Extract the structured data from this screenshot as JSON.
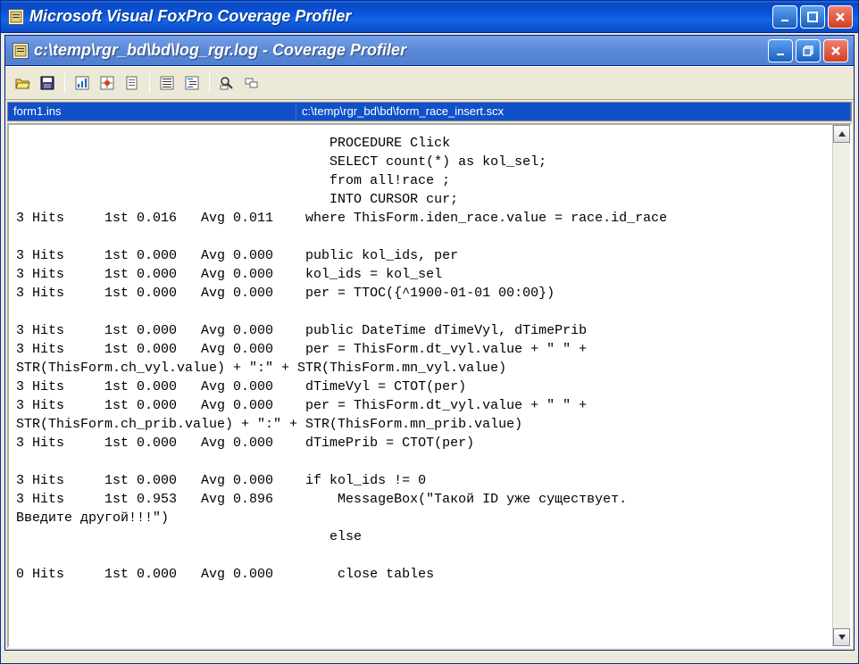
{
  "outer": {
    "title": "Microsoft Visual FoxPro Coverage Profiler"
  },
  "inner": {
    "title": "c:\\temp\\rgr_bd\\bd\\log_rgr.log - Coverage Profiler"
  },
  "header": {
    "col1": "form1.ins",
    "col2": "c:\\temp\\rgr_bd\\bd\\form_race_insert.scx"
  },
  "code_lines": [
    "                                       PROCEDURE Click",
    "                                       SELECT count(*) as kol_sel;",
    "                                       from all!race ;",
    "                                       INTO CURSOR cur;",
    "3 Hits     1st 0.016   Avg 0.011    where ThisForm.iden_race.value = race.id_race",
    "",
    "3 Hits     1st 0.000   Avg 0.000    public kol_ids, per",
    "3 Hits     1st 0.000   Avg 0.000    kol_ids = kol_sel",
    "3 Hits     1st 0.000   Avg 0.000    per = TTOC({^1900-01-01 00:00})",
    "",
    "3 Hits     1st 0.000   Avg 0.000    public DateTime dTimeVyl, dTimePrib",
    "3 Hits     1st 0.000   Avg 0.000    per = ThisForm.dt_vyl.value + \" \" +",
    "STR(ThisForm.ch_vyl.value) + \":\" + STR(ThisForm.mn_vyl.value)",
    "3 Hits     1st 0.000   Avg 0.000    dTimeVyl = CTOT(per)",
    "3 Hits     1st 0.000   Avg 0.000    per = ThisForm.dt_vyl.value + \" \" +",
    "STR(ThisForm.ch_prib.value) + \":\" + STR(ThisForm.mn_prib.value)",
    "3 Hits     1st 0.000   Avg 0.000    dTimePrib = CTOT(per)",
    "",
    "3 Hits     1st 0.000   Avg 0.000    if kol_ids != 0",
    "3 Hits     1st 0.953   Avg 0.896        MessageBox(\"Такой ID уже существует.",
    "Введите другой!!!\")",
    "                                       else",
    "",
    "0 Hits     1st 0.000   Avg 0.000        close tables"
  ]
}
